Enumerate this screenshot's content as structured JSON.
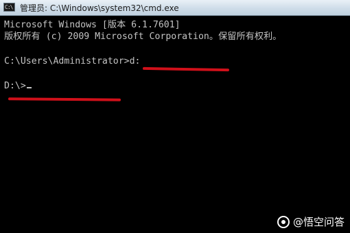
{
  "window": {
    "title": "管理员: C:\\Windows\\system32\\cmd.exe",
    "icon": "cmd-icon",
    "icon_text": "C:\\"
  },
  "console": {
    "lines": [
      "Microsoft Windows [版本 6.1.7601]",
      "版权所有 (c) 2009 Microsoft Corporation。保留所有权利。",
      "",
      "C:\\Users\\Administrator>d:",
      "",
      "D:\\>"
    ]
  },
  "annotation_color": "#d0101a",
  "watermark": {
    "text": "@悟空问答",
    "icon": "wukong-logo-icon"
  }
}
